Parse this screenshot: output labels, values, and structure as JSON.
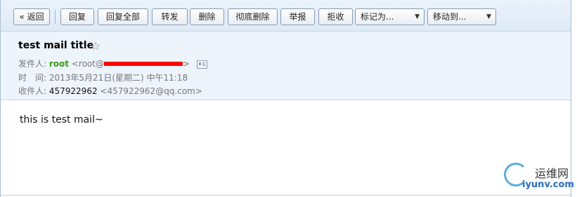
{
  "toolbar": {
    "back": "« 返回",
    "reply": "回复",
    "reply_all": "回复全部",
    "forward": "转发",
    "delete": "删除",
    "delete_permanently": "彻底删除",
    "report": "举报",
    "reject": "拒收",
    "mark_as": "标记为...",
    "move_to": "移动到..."
  },
  "mail": {
    "subject": "test mail title",
    "sender_label": "发件人:",
    "sender_name": "root",
    "sender_addr_prefix": "<root@",
    "sender_addr_suffix": ">",
    "time_label": "时　间:",
    "time_value": "2013年5月21日(星期二) 中午11:18",
    "recipient_label": "收件人:",
    "recipient_name": "457922962",
    "recipient_addr": "<457922962@qq.com>",
    "body": "this is test mail~"
  },
  "watermark": {
    "cn": "运维网",
    "en": "iyunv.com"
  },
  "icons": {
    "star": "star-icon",
    "contact_card": "contact-card-icon",
    "dropdown": "chevron-down-icon"
  }
}
